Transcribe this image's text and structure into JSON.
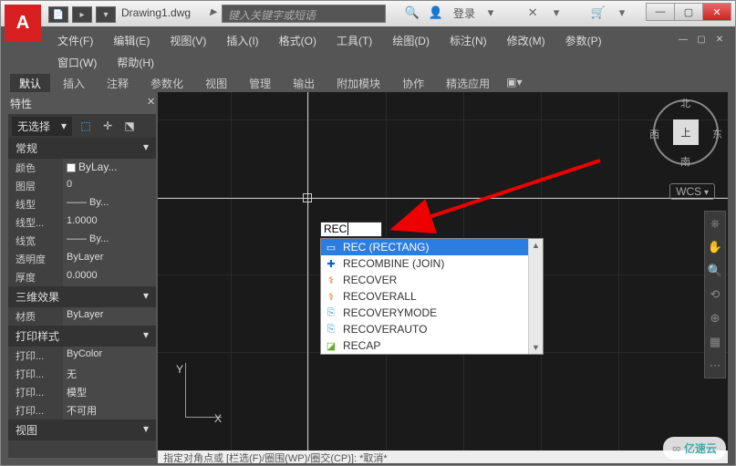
{
  "title": "Drawing1.dwg",
  "search_placeholder": "键入关键字或短语",
  "login": "登录",
  "menu": {
    "file": "文件(F)",
    "edit": "编辑(E)",
    "view": "视图(V)",
    "insert": "插入(I)",
    "format": "格式(O)",
    "tools": "工具(T)",
    "draw": "绘图(D)",
    "dimension": "标注(N)",
    "modify": "修改(M)",
    "param": "参数(P)",
    "window": "窗口(W)",
    "help": "帮助(H)"
  },
  "ribbon": [
    "默认",
    "插入",
    "注释",
    "参数化",
    "视图",
    "管理",
    "输出",
    "附加模块",
    "协作",
    "精选应用"
  ],
  "props_title": "特性",
  "sel_combo": "无选择",
  "sections": {
    "general": "常规",
    "threed": "三维效果",
    "plot": "打印样式",
    "viewsec": "视图"
  },
  "rows": {
    "color_l": "颜色",
    "color_v": "ByLay...",
    "layer_l": "图层",
    "layer_v": "0",
    "ltype_l": "线型",
    "ltype_v": "—— By...",
    "lscale_l": "线型...",
    "lscale_v": "1.0000",
    "lweight_l": "线宽",
    "lweight_v": "—— By...",
    "transp_l": "透明度",
    "transp_v": "ByLayer",
    "thick_l": "厚度",
    "thick_v": "0.0000",
    "mat_l": "材质",
    "mat_v": "ByLayer",
    "pstyle_l": "打印...",
    "pstyle_v": "ByColor",
    "pstyle2_l": "打印...",
    "pstyle2_v": "无",
    "ptable_l": "打印...",
    "ptable_v": "模型",
    "ptable2_l": "打印...",
    "ptable2_v": "不可用"
  },
  "ucs": {
    "x": "X",
    "y": "Y"
  },
  "cmd_input": "REC",
  "autocomplete": [
    "REC (RECTANG)",
    "RECOMBINE (JOIN)",
    "RECOVER",
    "RECOVERALL",
    "RECOVERYMODE",
    "RECOVERAUTO",
    "RECAP"
  ],
  "viewcube": {
    "face": "上",
    "n": "北",
    "s": "南",
    "e": "东",
    "w": "西"
  },
  "wcs": "WCS",
  "cmd_line": "指定对角点或  [栏选(F)/圈围(WP)/圈交(CP)]:  *取消*",
  "watermark": "亿速云"
}
